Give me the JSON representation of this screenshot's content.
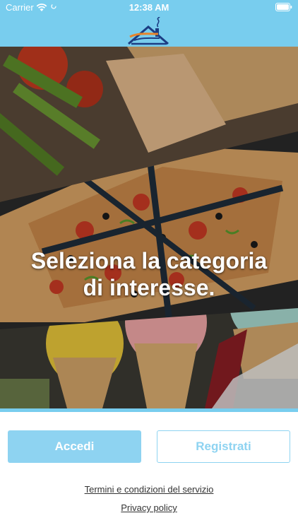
{
  "status_bar": {
    "carrier": "Carrier",
    "time": "12:38 AM"
  },
  "nav": {
    "logo": "house-roof-logo"
  },
  "carousel": {
    "headline_line1": "Seleziona la categoria",
    "headline_line2": "di interesse.",
    "page_count": 3,
    "active_page": 1
  },
  "buttons": {
    "login_label": "Accedi",
    "register_label": "Registrati"
  },
  "links": {
    "terms": "Termini e condizioni del servizio",
    "privacy": "Privacy policy"
  },
  "colors": {
    "accent": "#78cdee",
    "button_fill": "#8ed3f1",
    "text": "#333333"
  }
}
